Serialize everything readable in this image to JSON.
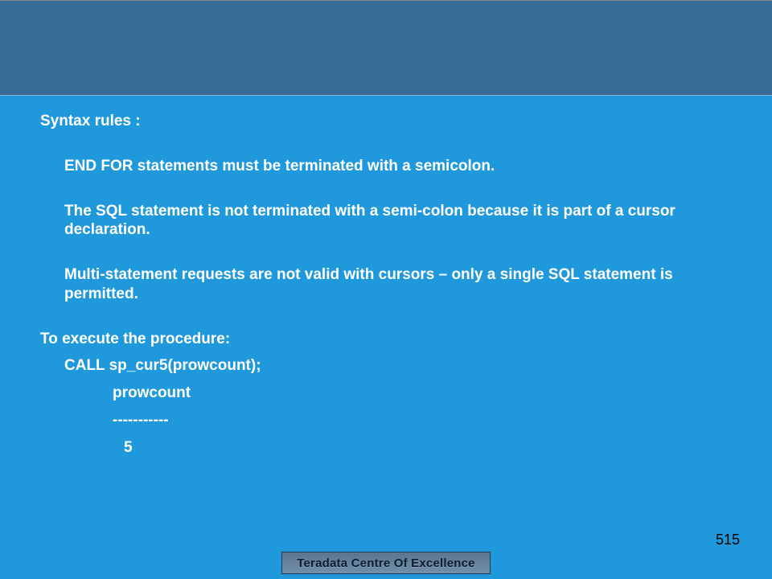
{
  "content": {
    "syntax_rules_heading": "Syntax rules :",
    "rule1": "END FOR statements must be terminated with a semicolon.",
    "rule2": "The SQL statement is not terminated with a semi-colon because it is part of a cursor declaration.",
    "rule3": "Multi-statement requests are not valid with cursors – only a single SQL statement is permitted.",
    "execute_heading": "To execute the procedure:",
    "call_line": "CALL sp_cur5(prowcount);",
    "result_col": "prowcount",
    "result_dash": "-----------",
    "result_val": "5"
  },
  "footer": {
    "logo_text": "Teradata Centre Of Excellence",
    "page_number": "515"
  }
}
